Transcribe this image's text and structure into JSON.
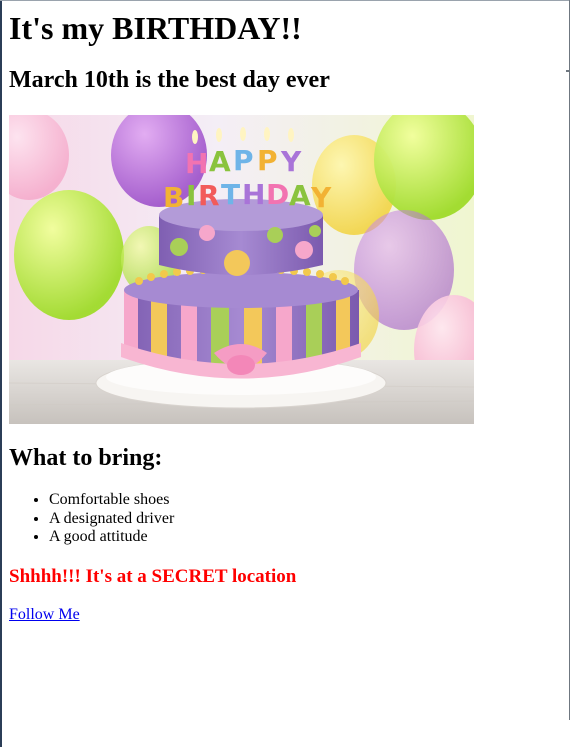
{
  "page": {
    "title": "It's my BIRTHDAY!!",
    "subtitle": "March 10th is the best day ever"
  },
  "hero_image": {
    "alt": "Birthday cake with candles",
    "cake_text_top": "HAPPY",
    "cake_text_bottom": "BIRTHDAY"
  },
  "bring": {
    "title": "What to bring:",
    "items": [
      "Comfortable shoes",
      "A designated driver",
      "A good attitude"
    ]
  },
  "secret": {
    "text": "Shhhh!!! It's at a SECRET location",
    "color": "#ff0000"
  },
  "link": {
    "label": "Follow Me",
    "color": "#0000ee"
  }
}
